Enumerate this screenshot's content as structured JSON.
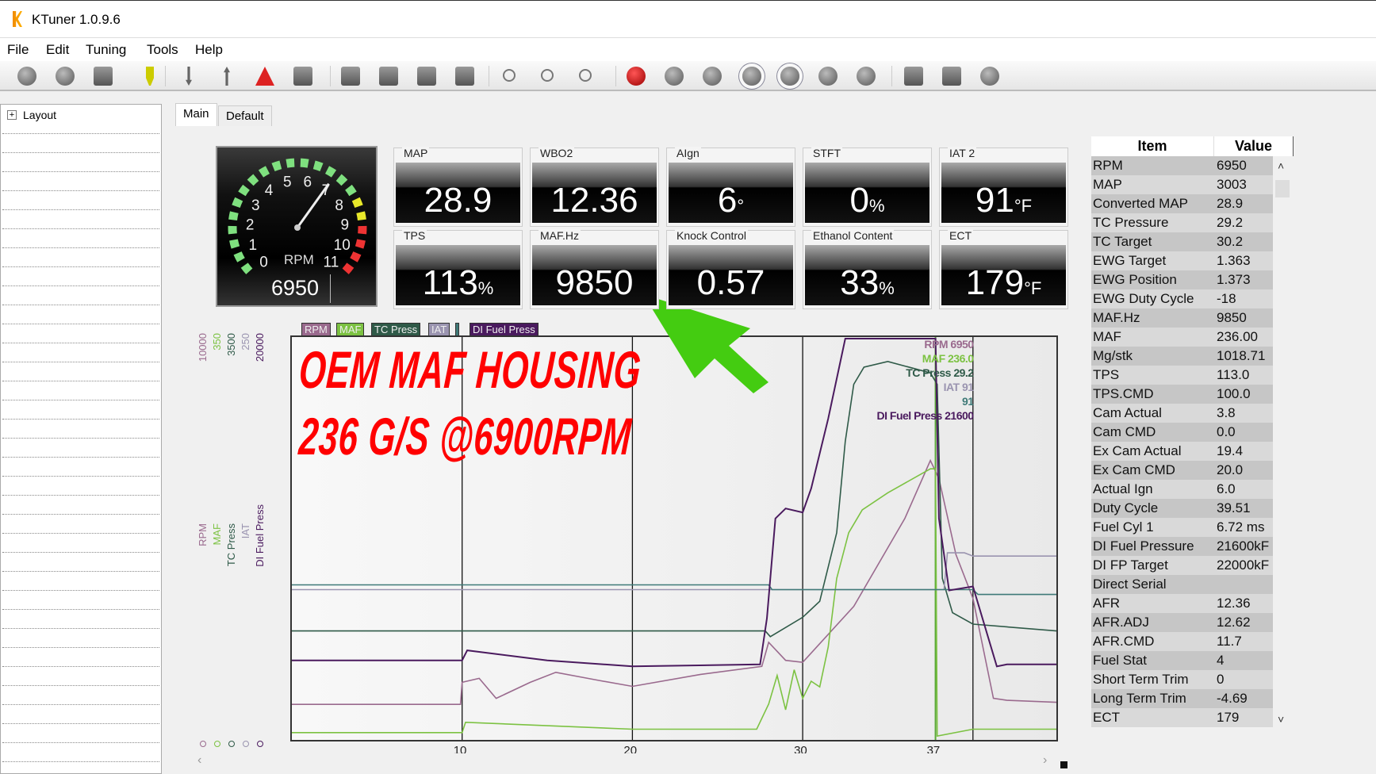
{
  "app": {
    "title": "KTuner 1.0.9.6",
    "logo": "ktuner-logo"
  },
  "menu": [
    "File",
    "Edit",
    "Tuning",
    "Tools",
    "Help"
  ],
  "toolbar": [
    "disconnect-icon",
    "connect-icon",
    "read-ecu-icon",
    "plug-icon",
    "download-icon",
    "upload-icon",
    "warning-icon",
    "monitor-icon",
    "compare-icon",
    "save-icon",
    "save-as-icon",
    "chip-icon",
    "zoom-icon",
    "zoom-in-icon",
    "zoom-out-icon",
    "record-icon",
    "rewind-icon",
    "back-icon",
    "play-icon",
    "pause-icon",
    "forward-icon",
    "end-icon",
    "user-icon",
    "gear-icon",
    "help-icon"
  ],
  "left_panel": {
    "root": "Layout"
  },
  "tabs": [
    {
      "label": "Main",
      "active": true
    },
    {
      "label": "Default",
      "active": false
    }
  ],
  "gauge": {
    "label": "RPM",
    "value": "6950",
    "ticks": [
      "0",
      "1",
      "2",
      "3",
      "4",
      "5",
      "6",
      "7",
      "8",
      "9",
      "10",
      "11"
    ],
    "needle_krpm": 6.95,
    "max_krpm": 11,
    "colors": {
      "green": "#7fe07f",
      "yellow": "#e8e82a",
      "red": "#ee3333"
    }
  },
  "tiles": [
    {
      "label": "MAP",
      "value": "28.9",
      "unit": ""
    },
    {
      "label": "WBO2",
      "value": "12.36",
      "unit": ""
    },
    {
      "label": "AIgn",
      "value": "6",
      "unit": "°"
    },
    {
      "label": "STFT",
      "value": "0",
      "unit": "%"
    },
    {
      "label": "IAT 2",
      "value": "91",
      "unit": "°F"
    },
    {
      "label": "TPS",
      "value": "113",
      "unit": "%"
    },
    {
      "label": "MAF.Hz",
      "value": "9850",
      "unit": ""
    },
    {
      "label": "Knock Control",
      "value": "0.57",
      "unit": ""
    },
    {
      "label": "Ethanol Content",
      "value": "33",
      "unit": "%"
    },
    {
      "label": "ECT",
      "value": "179",
      "unit": "°F"
    }
  ],
  "overlay": {
    "line1": "OEM MAF HOUSING",
    "line2": "236 G/S @6900RPM",
    "text_color": "#ff0000",
    "arrow_color": "#44cc11"
  },
  "chart_data": {
    "type": "line",
    "xticks": [
      "10",
      "20",
      "30",
      "37"
    ],
    "xtick_values": [
      10,
      20,
      30,
      37.8
    ],
    "gridlines_x": [
      10,
      20,
      30,
      40
    ],
    "cursor_x": 37.8,
    "xlim": [
      0,
      44.9
    ],
    "series": [
      {
        "name": "RPM",
        "color": "#9a6a8e",
        "ymax": "10000",
        "readout": "6950",
        "x": [
          0,
          9.9,
          10,
          11,
          12,
          14,
          15.5,
          18,
          20,
          24,
          27.6,
          28,
          29,
          30,
          33,
          36,
          37.5,
          38,
          39,
          40,
          41.2,
          42,
          44.9
        ],
        "y": [
          850,
          850,
          1400,
          1500,
          1000,
          1400,
          1650,
          1450,
          1300,
          1600,
          1800,
          2400,
          1950,
          1900,
          3300,
          5500,
          6950,
          6500,
          4600,
          3500,
          1000,
          950,
          900
        ]
      },
      {
        "name": "MAF",
        "color": "#7cc242",
        "ymax": "350",
        "readout": "236.0",
        "x": [
          0,
          10,
          10.2,
          20,
          27.3,
          28,
          28.5,
          29,
          29.5,
          30,
          30.5,
          31,
          31.5,
          32,
          32.7,
          33.5,
          35,
          37.5,
          37.8,
          37.9,
          40,
          44.9
        ],
        "y": [
          5,
          5,
          14,
          8,
          8,
          30,
          55,
          25,
          60,
          35,
          50,
          45,
          80,
          140,
          180,
          200,
          215,
          236,
          236,
          2,
          8,
          8
        ]
      },
      {
        "name": "TC Press",
        "color": "#2f5a48",
        "ymax": "3500",
        "readout": "29.2",
        "x": [
          0,
          27.8,
          28.1,
          30,
          31,
          32,
          32.5,
          33,
          33.6,
          35,
          37.5,
          37.9,
          38.2,
          38.8,
          40,
          44.9
        ],
        "y": [
          940,
          940,
          890,
          1060,
          1200,
          1800,
          2600,
          3100,
          3250,
          3300,
          3200,
          3100,
          1400,
          1100,
          1000,
          940
        ]
      },
      {
        "name": "IAT",
        "color": "#9a94b0",
        "ymax": "250",
        "readout": "91",
        "x": [
          0,
          38.3,
          38.5,
          39.5,
          40,
          44.9
        ],
        "y": [
          93,
          93,
          116,
          116,
          114,
          114
        ]
      },
      {
        "name": "",
        "color": "#3f7a78",
        "ymax": "250",
        "readout": "91",
        "x": [
          0,
          28,
          28.2,
          40,
          40.3,
          44.9
        ],
        "y": [
          96,
          96,
          93,
          93,
          90,
          90
        ]
      },
      {
        "name": "DI Fuel Press",
        "color": "#4a1a5e",
        "ymax": "20000",
        "readout": "21600",
        "x": [
          0,
          5,
          10,
          10.3,
          15,
          20,
          27.5,
          27.9,
          28.4,
          29,
          30,
          30.5,
          31.5,
          32.5,
          33,
          37.8,
          38,
          38.6,
          40,
          41.4,
          42,
          44.9
        ],
        "y": [
          3900,
          3900,
          3900,
          4400,
          3900,
          3600,
          3700,
          6000,
          11000,
          11500,
          11300,
          12500,
          16000,
          20000,
          20000,
          20000,
          11000,
          7400,
          7600,
          3600,
          3700,
          3700
        ]
      }
    ],
    "ymin": "0"
  },
  "table": {
    "headers": [
      "Item",
      "Value"
    ],
    "rows": [
      [
        "RPM",
        "6950"
      ],
      [
        "MAP",
        "3003"
      ],
      [
        "Converted MAP",
        "28.9"
      ],
      [
        "TC Pressure",
        "29.2"
      ],
      [
        "TC Target",
        "30.2"
      ],
      [
        "EWG Target",
        "1.363"
      ],
      [
        "EWG Position",
        "1.373"
      ],
      [
        "EWG Duty Cycle",
        "-18"
      ],
      [
        "MAF.Hz",
        "9850"
      ],
      [
        "MAF",
        "236.00"
      ],
      [
        "Mg/stk",
        "1018.71"
      ],
      [
        "TPS",
        "113.0"
      ],
      [
        "TPS.CMD",
        "100.0"
      ],
      [
        "Cam Actual",
        "3.8"
      ],
      [
        "Cam CMD",
        "0.0"
      ],
      [
        "Ex Cam Actual",
        "19.4"
      ],
      [
        "Ex Cam CMD",
        "20.0"
      ],
      [
        "Actual Ign",
        "6.0"
      ],
      [
        "Duty Cycle",
        "39.51"
      ],
      [
        "Fuel Cyl 1",
        "6.72 ms"
      ],
      [
        "DI Fuel Pressure",
        "21600kF"
      ],
      [
        "DI FP Target",
        "22000kF"
      ],
      [
        "Direct Serial",
        ""
      ],
      [
        "AFR",
        "12.36"
      ],
      [
        "AFR.ADJ",
        "12.62"
      ],
      [
        "AFR.CMD",
        "11.7"
      ],
      [
        "Fuel Stat",
        "4"
      ],
      [
        "Short Term Trim",
        "0"
      ],
      [
        "Long Term Trim",
        "-4.69"
      ],
      [
        "ECT",
        "179"
      ]
    ]
  }
}
